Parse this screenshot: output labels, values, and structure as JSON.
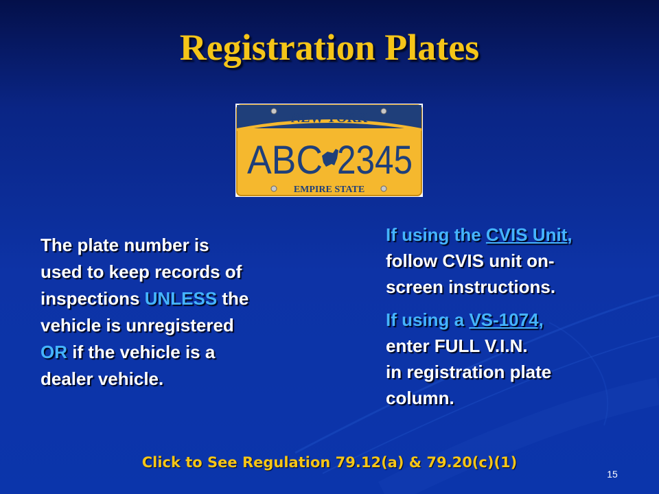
{
  "slide": {
    "title": "Registration Plates",
    "page_number": "15"
  },
  "plate": {
    "state": "NEW YORK",
    "number_left": "ABC",
    "number_right": "2345",
    "motto": "EMPIRE STATE",
    "colors": {
      "background": "#f5b82e",
      "band": "#1f3f7a",
      "text": "#1f3f7a"
    }
  },
  "left_paragraph": {
    "line1": "The plate number is",
    "line2": "used to keep records of",
    "line3_before": "inspections ",
    "line3_highlight": "UNLESS",
    "line3_after": " the",
    "line4": "vehicle is unregistered",
    "line5_highlight": "OR",
    "line5_after": " if the vehicle is a",
    "line6": "dealer vehicle."
  },
  "right_paragraph": {
    "cvis_prefix": "If using the ",
    "cvis_link": "CVIS Unit",
    "cvis_suffix": ",",
    "cvis_line2": "follow CVIS unit on-",
    "cvis_line3": "screen instructions.",
    "vs_prefix": "If using a ",
    "vs_link": "VS-1074,",
    "vs_line2": "enter FULL V.I.N.",
    "vs_line3": "in registration plate",
    "vs_line4": "column."
  },
  "regulation_link": "Click to See Regulation 79.12(a) & 79.20(c)(1)",
  "theme": {
    "title_color": "#f5c518",
    "highlight_color": "#45b4ff",
    "background": "#0d33a6"
  }
}
